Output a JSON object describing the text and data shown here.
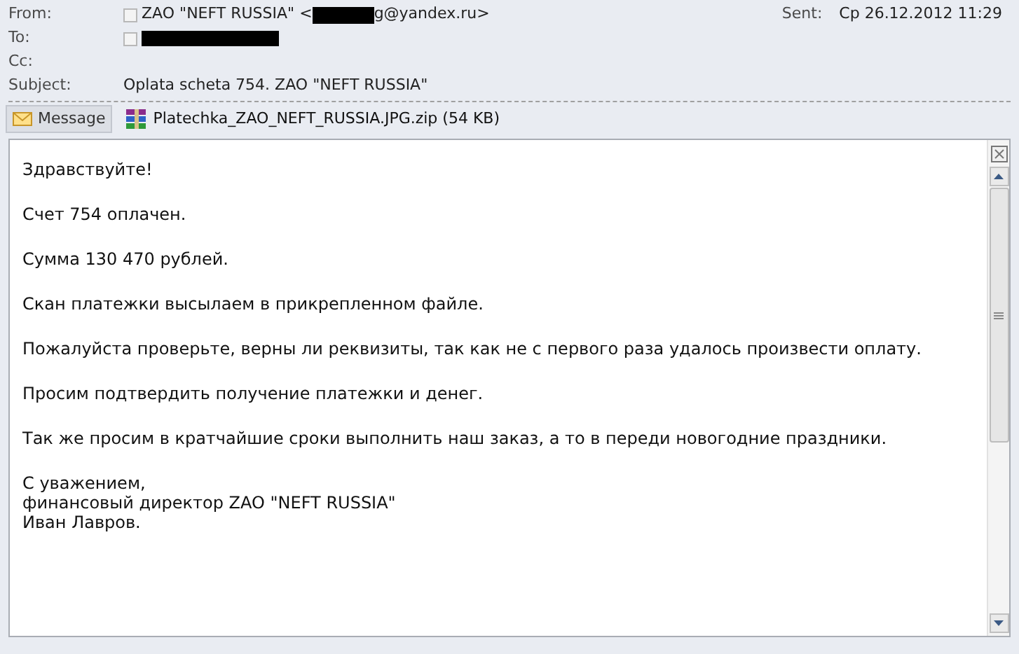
{
  "header": {
    "from": {
      "label": "From:",
      "name": "ZAO \"NEFT RUSSIA\" <",
      "address_tail": "g@yandex.ru>"
    },
    "to": {
      "label": "To:"
    },
    "cc": {
      "label": "Cc:"
    },
    "subject": {
      "label": "Subject:",
      "value": "Oplata scheta 754. ZAO \"NEFT RUSSIA\""
    },
    "sent": {
      "label": "Sent:",
      "value": "Ср 26.12.2012 11:29"
    }
  },
  "attachments": [
    {
      "kind": "message",
      "label": "Message",
      "selected": true
    },
    {
      "kind": "archive",
      "label": "Platechka_ZAO_NEFT_RUSSIA.JPG.zip (54 KB)",
      "selected": false
    }
  ],
  "body": {
    "paragraphs": [
      "Здравствуйте!",
      "Счет 754 оплачен.",
      "Сумма 130 470 рублей.",
      "Скан платежки высылаем в прикрепленном файле.",
      "Пожалуйста проверьте, верны ли реквизиты, так как не с первого раза удалось произвести оплату.",
      "Просим подтвердить получение платежки и денег.",
      "Так же просим в кратчайшие сроки выполнить наш заказ, а то в переди новогодние праздники."
    ],
    "signature": [
      "С уважением,",
      "финансовый директор ZAO \"NEFT RUSSIA\"",
      "Иван Лавров."
    ]
  }
}
